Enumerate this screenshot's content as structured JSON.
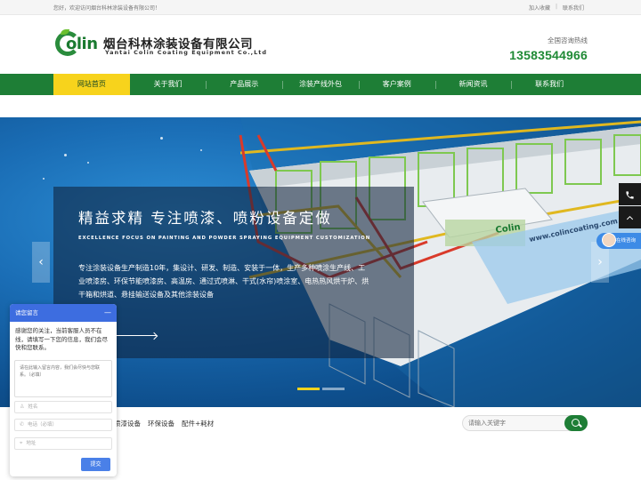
{
  "topbar": {
    "welcome": "您好，欢迎访问烟台科林涂装设备有限公司！",
    "add_favorite": "加入收藏",
    "separator": "|",
    "contact": "联系我们"
  },
  "logo": {
    "mark_text": "olin",
    "name_cn": "烟台科林涂装设备有限公司",
    "name_en": "Yantai Colin Coating Equipment Co.,Ltd"
  },
  "hotline": {
    "label": "全国咨询热线",
    "phone": "13583544966"
  },
  "nav": {
    "items": [
      {
        "label": "网站首页",
        "active": true
      },
      {
        "label": "关于我们"
      },
      {
        "label": "产品展示"
      },
      {
        "label": "涂装产线外包"
      },
      {
        "label": "客户案例"
      },
      {
        "label": "新闻资讯"
      },
      {
        "label": "联系我们"
      }
    ]
  },
  "banner": {
    "slogan_cn": "精益求精  专注喷漆、喷粉设备定做",
    "slogan_en": "EXCELLENCE  FOCUS ON PAINTING AND POWDER SPRAYING EQUIPMENT CUSTOMIZATION",
    "description": "专注涂装设备生产制造10年，集设计、研发、制造、安装于一体，生产多种喷涂生产线、工业喷漆房、环保节能喷漆房、高温房、通过式喷淋、干式(水帘)喷涂室、电热热风烘干炉、烘干箱和烘道、悬挂输送设备及其他涂装设备",
    "brand_badge": "Colin",
    "website_text": "www.colincoating.com",
    "prev_icon": "‹",
    "next_icon": "›",
    "slide_count": 2,
    "active_slide": 0
  },
  "float": {
    "phone_icon": "phone-icon",
    "top_icon": "chevron-up-icon",
    "online_label": "在线咨询"
  },
  "categories": {
    "items": [
      "喷漆设备",
      "环保设备",
      "配件+耗材"
    ]
  },
  "search": {
    "placeholder": "请输入关键字"
  },
  "chat": {
    "title": "请您留言",
    "minimize": "—",
    "intro": "感谢您的关注，当前客服人员不在线，请填写一下您的信息，我们会尽快和您联系。",
    "message_placeholder": "请在此输入留言内容，我们会尽快与您联系。（必填）",
    "name_placeholder": "姓名",
    "phone_placeholder": "电话（必填）",
    "address_placeholder": "地址",
    "submit": "提交"
  },
  "colors": {
    "brand_green": "#1e7e36",
    "nav_active": "#f7d31c",
    "chat_blue": "#3d6de0"
  }
}
